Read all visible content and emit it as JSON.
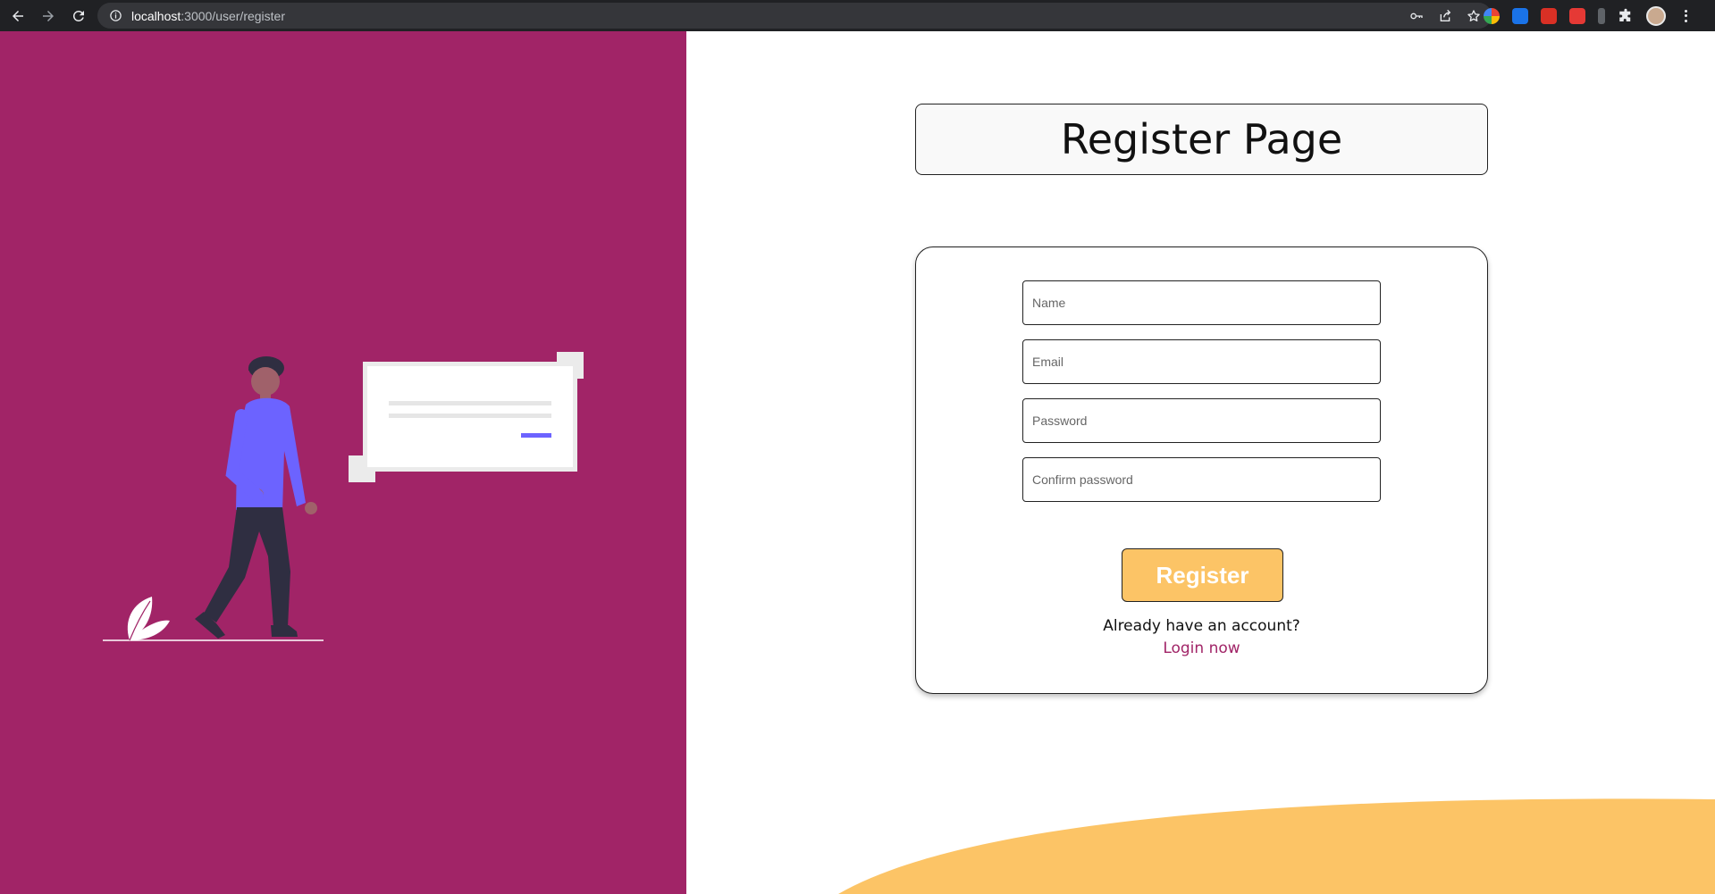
{
  "browser": {
    "url_host": "localhost",
    "url_path": ":3000/user/register"
  },
  "page": {
    "title": "Register Page"
  },
  "form": {
    "name_placeholder": "Name",
    "email_placeholder": "Email",
    "password_placeholder": "Password",
    "confirm_placeholder": "Confirm password",
    "submit_label": "Register",
    "account_prompt": "Already have an account?",
    "login_link": "Login now"
  },
  "colors": {
    "left_panel": "#a12467",
    "accent": "#fcc466",
    "link": "#a12467",
    "figure_shirt": "#6c63ff",
    "figure_pants": "#2f2e41"
  },
  "icons": [
    "back-arrow-icon",
    "forward-arrow-icon",
    "reload-icon",
    "info-icon",
    "key-icon",
    "share-icon",
    "star-icon",
    "extensions-puzzle-icon",
    "menu-kebab-icon"
  ]
}
